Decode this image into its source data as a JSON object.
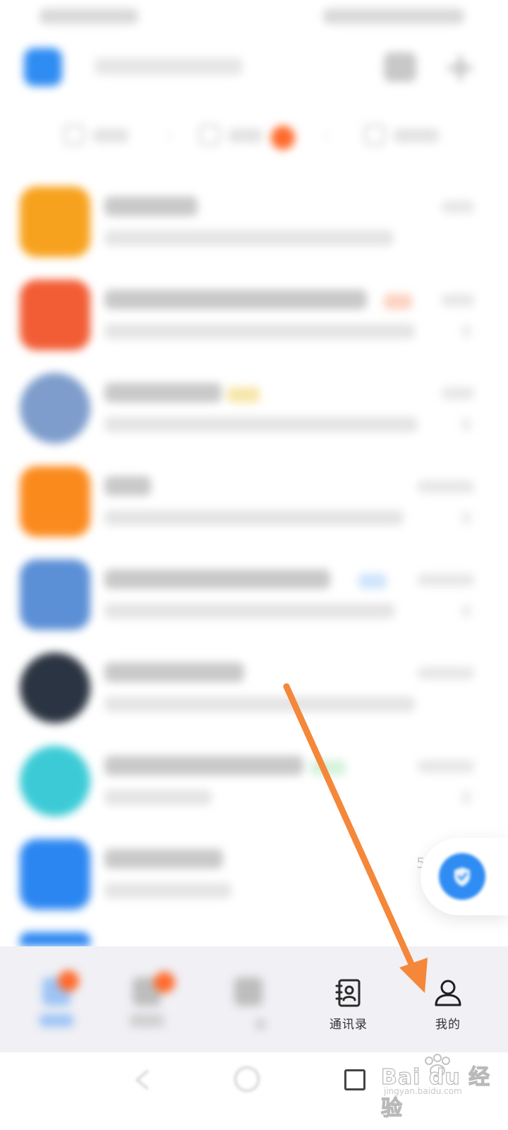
{
  "bottom_nav": {
    "items": [
      {
        "id": "messages",
        "label": ""
      },
      {
        "id": "docs",
        "label": ""
      },
      {
        "id": "workbench",
        "label": "台"
      },
      {
        "id": "contacts",
        "label": "通讯录"
      },
      {
        "id": "me",
        "label": "我的"
      }
    ]
  },
  "fab": {
    "partial_number": "5"
  },
  "watermark": {
    "brand": "Bai du 经验",
    "url": "jingyan.baidu.com"
  },
  "colors": {
    "accent_blue": "#2f8cf2",
    "badge_orange": "#ff6a2b",
    "arrow_orange": "#f5873a",
    "nav_background": "#f0f0f5"
  },
  "icons": {
    "contacts": "contacts-book-icon",
    "me": "person-icon",
    "fab": "shield-check-icon",
    "recent": "square-icon"
  }
}
